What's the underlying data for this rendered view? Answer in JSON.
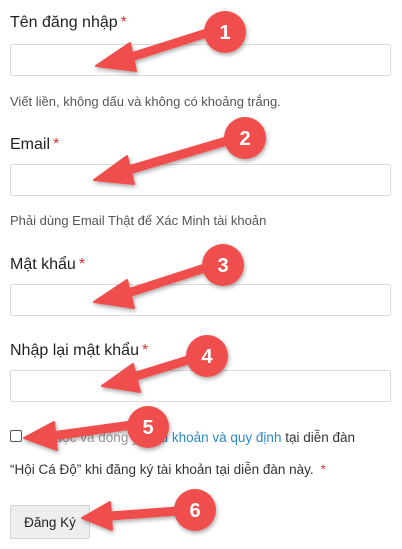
{
  "form": {
    "username": {
      "label": "Tên đăng nhập",
      "required": "*",
      "value": "",
      "hint": "Viết liền, không dấu và không có khoảng trắng."
    },
    "email": {
      "label": "Email",
      "required": "*",
      "value": "",
      "hint": "Phải dùng Email Thật để Xác Minh tài khoản"
    },
    "password": {
      "label": "Mật khẩu",
      "required": "*",
      "value": ""
    },
    "password_confirm": {
      "label": "Nhập lại mật khẩu",
      "required": "*",
      "value": ""
    },
    "agreement": {
      "checked": false,
      "text_before_visible": "đã đọc và đồng ý",
      "link_text": "điều khoản và quy định",
      "text_after": "tại diễn đàn",
      "line2": "“Hội Cá Độ” khi đăng ký tài khoản tại diễn đàn này.",
      "required": "*"
    },
    "submit_label": "Đăng Ký"
  },
  "annotations": {
    "color": "#f04e4e",
    "badges": [
      "1",
      "2",
      "3",
      "4",
      "5",
      "6"
    ]
  }
}
